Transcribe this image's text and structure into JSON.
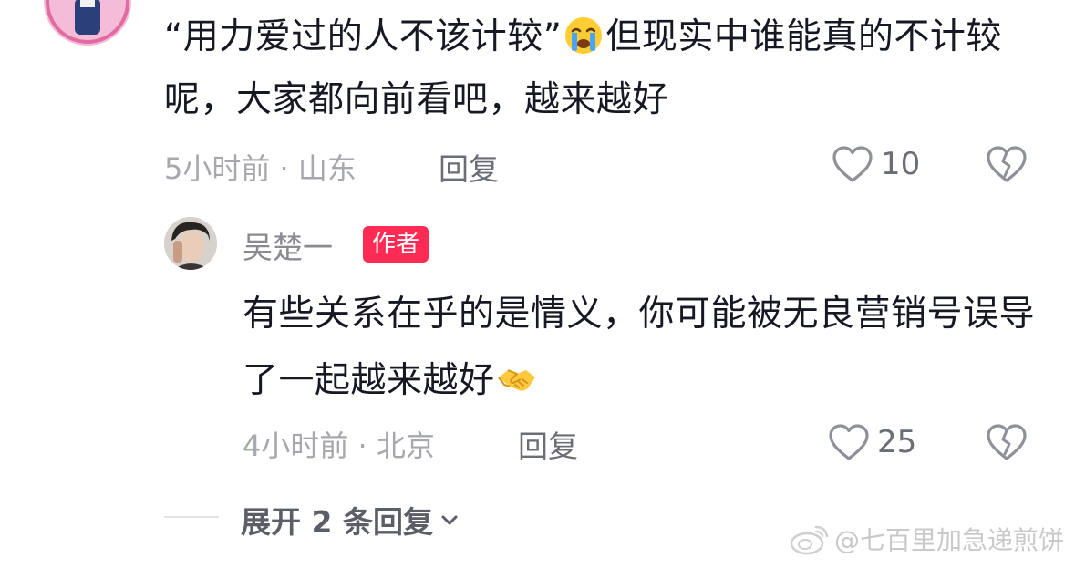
{
  "parent_comment": {
    "text_part1": "“用力爱过的人不该计较”",
    "emoji": "loudly-crying-face",
    "text_part2": "但现实中谁能真的不计较呢，大家都向前看吧，越来越好",
    "time_location": "5小时前 · 山东",
    "reply_label": "回复",
    "like_count": "10"
  },
  "reply_comment": {
    "username": "吴楚一",
    "badge": "作者",
    "text": "有些关系在乎的是情义，你可能被无良营销号误导了一起越来越好",
    "emoji": "handshake",
    "time_location": "4小时前 · 北京",
    "reply_label": "回复",
    "like_count": "25"
  },
  "expand": {
    "label": "展开 2 条回复"
  },
  "watermark": {
    "text": "@七百里加急递煎饼"
  },
  "colors": {
    "badge_bg": "#fe2c55",
    "meta_text": "#a7a8ad",
    "main_text": "#161823"
  }
}
